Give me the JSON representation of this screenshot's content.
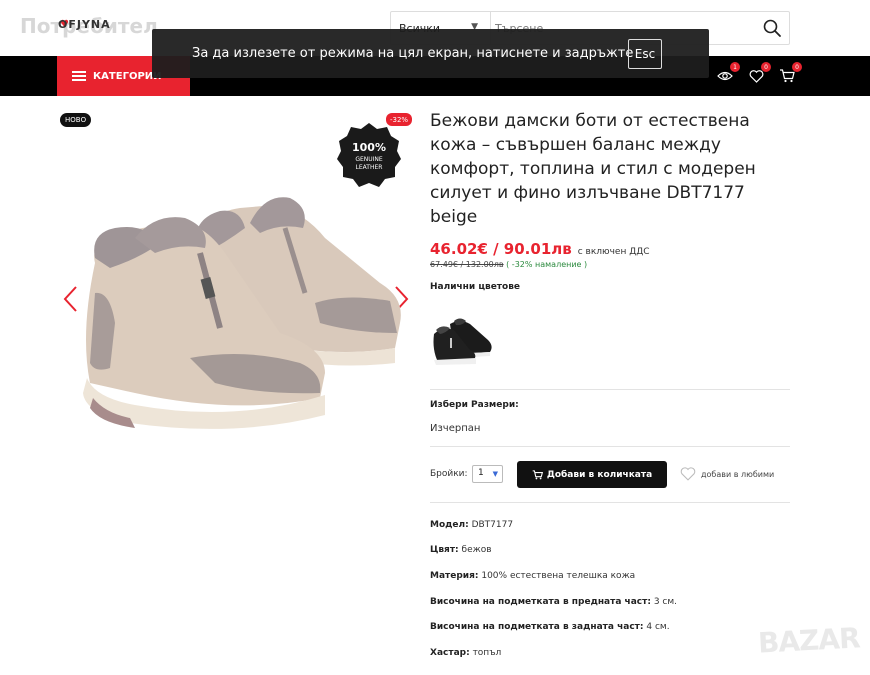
{
  "header": {
    "logo_back": "Потребител",
    "logo_brand": "OFJYNA",
    "search": {
      "category": "Всички",
      "placeholder": "Търсене"
    }
  },
  "fullscreen_notice": {
    "text": "За да излезете от режима на цял екран, натиснете и задръжте",
    "key": "Esc"
  },
  "nav": {
    "categories_label": "КАТЕГОРИИ",
    "badges": {
      "views": "1",
      "favorites": "0",
      "cart": "0"
    }
  },
  "gallery": {
    "badge_new": "НОВО",
    "badge_discount": "-32%",
    "seal_lines": [
      "100%",
      "GENUINE",
      "LEATHER"
    ]
  },
  "product": {
    "title": "Бежови дамски боти от естествена кожа – съвършен баланс между комфорт, топлина и стил с модерен силует и фино излъчване DBT7177 beige",
    "price_new": "46.02€ / 90.01лв",
    "price_vat": "с включен ДДС",
    "price_old": "67.49€ / 132.00лв",
    "discount_text": "( -32% намаление )",
    "colors_label": "Налични цветове",
    "sizes_label": "Избери Размери:",
    "sizes_value": "Изчерпан",
    "qty_label": "Бройки:",
    "qty_value": "1",
    "add_to_cart": "Добави в количката",
    "favorite": "добави в любими"
  },
  "specs": [
    {
      "label": "Модел:",
      "value": "DBT7177"
    },
    {
      "label": "Цвят:",
      "value": "бежов"
    },
    {
      "label": "Материя:",
      "value": "100% естествена телешка кожа"
    },
    {
      "label": "Височина на подметката в предната част:",
      "value": "3 см."
    },
    {
      "label": "Височина на подметката в задната част:",
      "value": "4 см."
    },
    {
      "label": "Хастар:",
      "value": "топъл"
    }
  ],
  "watermark": "BAZAR",
  "colors": {
    "accent": "#e8232f",
    "nav_bg": "#000000",
    "discount_green": "#2b8a3e"
  }
}
